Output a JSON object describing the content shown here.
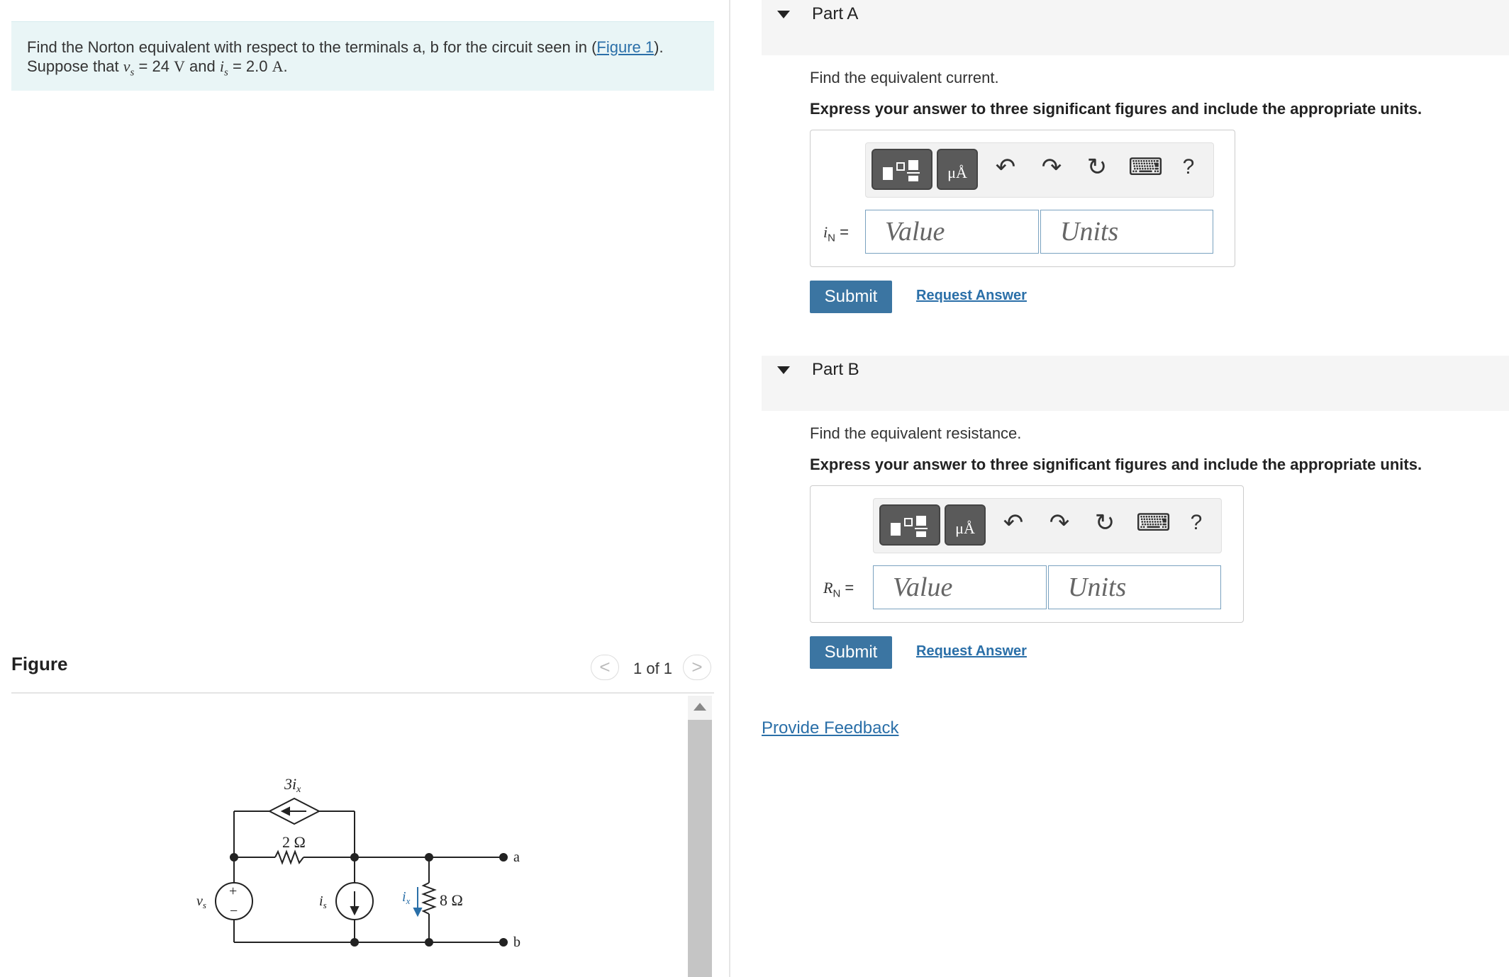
{
  "problem": {
    "text_before_link": "Find the Norton equivalent with respect to the terminals a, b for the circuit seen in (",
    "link_text": "Figure 1",
    "text_after_link": ").",
    "line2_prefix": "Suppose that ",
    "vs_symbol": "v",
    "vs_sub": "s",
    "vs_value": " = 24 ",
    "vs_unit": "V",
    "and": " and ",
    "is_symbol": "i",
    "is_sub": "s",
    "is_value": " = 2.0 ",
    "is_unit": "A",
    "end": "."
  },
  "figure": {
    "title": "Figure",
    "pager": "1 of 1",
    "prev": "<",
    "next": ">",
    "circuit": {
      "dep_source": "3i",
      "dep_source_sub": "x",
      "r1": "2 Ω",
      "r2": "8 Ω",
      "vs_label": "v",
      "vs_sub": "s",
      "is_label": "i",
      "is_sub": "s",
      "ix_label": "i",
      "ix_sub": "x",
      "plus": "+",
      "minus": "−",
      "terminal_a": "a",
      "terminal_b": "b"
    }
  },
  "partA": {
    "title": "Part A",
    "question": "Find the equivalent current.",
    "instruction": "Express your answer to three significant figures and include the appropriate units.",
    "var": "i",
    "var_sub": "N",
    "eq": " =",
    "value_placeholder": "Value",
    "units_placeholder": "Units",
    "submit": "Submit",
    "request": "Request Answer"
  },
  "partB": {
    "title": "Part B",
    "question": "Find the equivalent resistance.",
    "instruction": "Express your answer to three significant figures and include the appropriate units.",
    "var": "R",
    "var_sub": "N",
    "eq": " =",
    "value_placeholder": "Value",
    "units_placeholder": "Units",
    "submit": "Submit",
    "request": "Request Answer"
  },
  "toolbar": {
    "units_glyph": "μÅ",
    "undo": "↶",
    "redo": "↷",
    "reset": "↻",
    "keyboard": "⌨",
    "help": "?"
  },
  "feedback": "Provide Feedback",
  "colors": {
    "link": "#2a6fa8",
    "submit": "#3b75a2",
    "problem_bg": "#e9f5f6"
  }
}
